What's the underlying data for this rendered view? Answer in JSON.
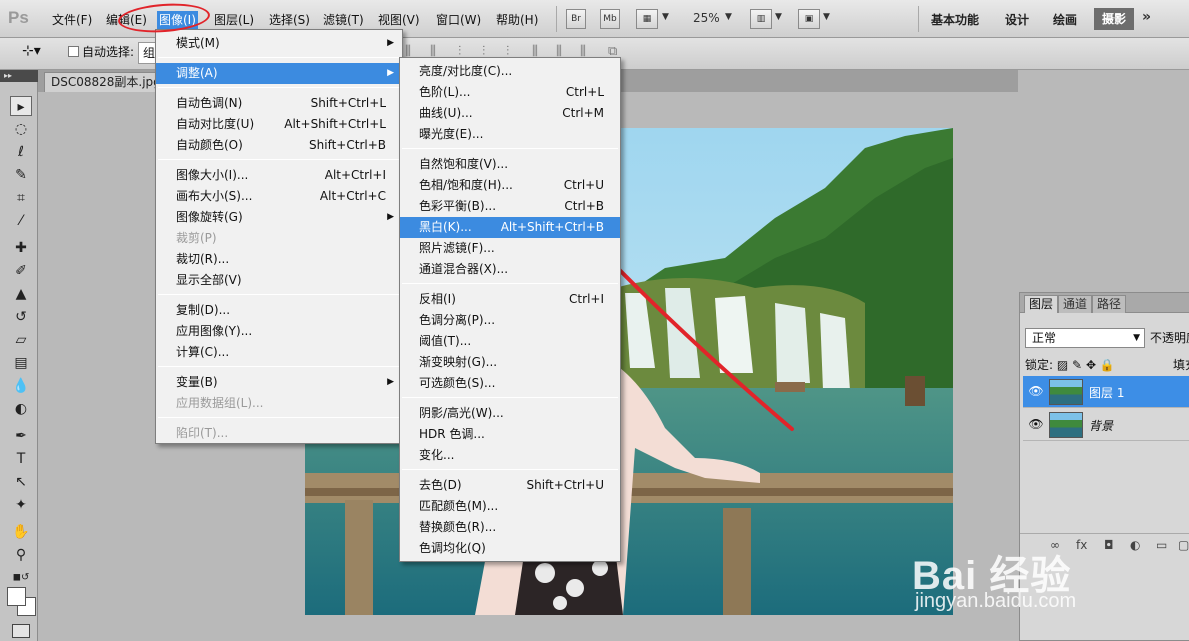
{
  "app": {
    "logo": "Ps"
  },
  "menubar": {
    "items": [
      {
        "label": "文件(F)"
      },
      {
        "label": "编辑(E)"
      },
      {
        "label": "图像(I)"
      },
      {
        "label": "图层(L)"
      },
      {
        "label": "选择(S)"
      },
      {
        "label": "滤镜(T)"
      },
      {
        "label": "视图(V)"
      },
      {
        "label": "窗口(W)"
      },
      {
        "label": "帮助(H)"
      }
    ],
    "bridge_btn": "Br",
    "minibridge_btn": "Mb",
    "zoom": "25%",
    "workspaces": [
      "基本功能",
      "设计",
      "绘画"
    ],
    "active_workspace": "摄影",
    "more": "»"
  },
  "options_bar": {
    "auto_select_label": "自动选择:",
    "auto_select_value": "组"
  },
  "document": {
    "tab_title": "DSC08828副本.jpg"
  },
  "toolbox": {
    "collapse": "▸▸"
  },
  "image_menu": [
    {
      "label": "模式(M)",
      "submenu": true
    },
    {
      "sep": true
    },
    {
      "label": "调整(A)",
      "submenu": true,
      "highlighted": true
    },
    {
      "sep": true
    },
    {
      "label": "自动色调(N)",
      "shortcut": "Shift+Ctrl+L"
    },
    {
      "label": "自动对比度(U)",
      "shortcut": "Alt+Shift+Ctrl+L"
    },
    {
      "label": "自动颜色(O)",
      "shortcut": "Shift+Ctrl+B"
    },
    {
      "sep": true
    },
    {
      "label": "图像大小(I)...",
      "shortcut": "Alt+Ctrl+I"
    },
    {
      "label": "画布大小(S)...",
      "shortcut": "Alt+Ctrl+C"
    },
    {
      "label": "图像旋转(G)",
      "submenu": true
    },
    {
      "label": "裁剪(P)",
      "disabled": true
    },
    {
      "label": "裁切(R)..."
    },
    {
      "label": "显示全部(V)"
    },
    {
      "sep": true
    },
    {
      "label": "复制(D)..."
    },
    {
      "label": "应用图像(Y)..."
    },
    {
      "label": "计算(C)..."
    },
    {
      "sep": true
    },
    {
      "label": "变量(B)",
      "submenu": true
    },
    {
      "label": "应用数据组(L)...",
      "disabled": true
    },
    {
      "sep": true
    },
    {
      "label": "陷印(T)...",
      "disabled": true
    }
  ],
  "adjust_menu": [
    {
      "label": "亮度/对比度(C)..."
    },
    {
      "label": "色阶(L)...",
      "shortcut": "Ctrl+L"
    },
    {
      "label": "曲线(U)...",
      "shortcut": "Ctrl+M"
    },
    {
      "label": "曝光度(E)..."
    },
    {
      "sep": true
    },
    {
      "label": "自然饱和度(V)..."
    },
    {
      "label": "色相/饱和度(H)...",
      "shortcut": "Ctrl+U"
    },
    {
      "label": "色彩平衡(B)...",
      "shortcut": "Ctrl+B"
    },
    {
      "label": "黑白(K)...",
      "shortcut": "Alt+Shift+Ctrl+B",
      "highlighted": true
    },
    {
      "label": "照片滤镜(F)..."
    },
    {
      "label": "通道混合器(X)..."
    },
    {
      "sep": true
    },
    {
      "label": "反相(I)",
      "shortcut": "Ctrl+I"
    },
    {
      "label": "色调分离(P)..."
    },
    {
      "label": "阈值(T)..."
    },
    {
      "label": "渐变映射(G)..."
    },
    {
      "label": "可选颜色(S)..."
    },
    {
      "sep": true
    },
    {
      "label": "阴影/高光(W)..."
    },
    {
      "label": "HDR 色调..."
    },
    {
      "label": "变化..."
    },
    {
      "sep": true
    },
    {
      "label": "去色(D)",
      "shortcut": "Shift+Ctrl+U"
    },
    {
      "label": "匹配颜色(M)..."
    },
    {
      "label": "替换颜色(R)..."
    },
    {
      "label": "色调均化(Q)"
    }
  ],
  "layers_panel": {
    "tabs": [
      "图层",
      "通道",
      "路径"
    ],
    "blend_mode": "正常",
    "opacity_label": "不透明度",
    "lock_label": "锁定:",
    "fill_label": "填充",
    "layers": [
      {
        "name": "图层 1",
        "selected": true,
        "italic": false
      },
      {
        "name": "背景",
        "selected": false,
        "italic": true
      }
    ]
  },
  "watermark": {
    "main": "Bai  经验",
    "sub": "jingyan.baidu.com"
  },
  "colors": {
    "menu_highlight": "#3c8be0",
    "annotation_red": "#e1242a",
    "layer_selected": "#3d8ee6"
  }
}
